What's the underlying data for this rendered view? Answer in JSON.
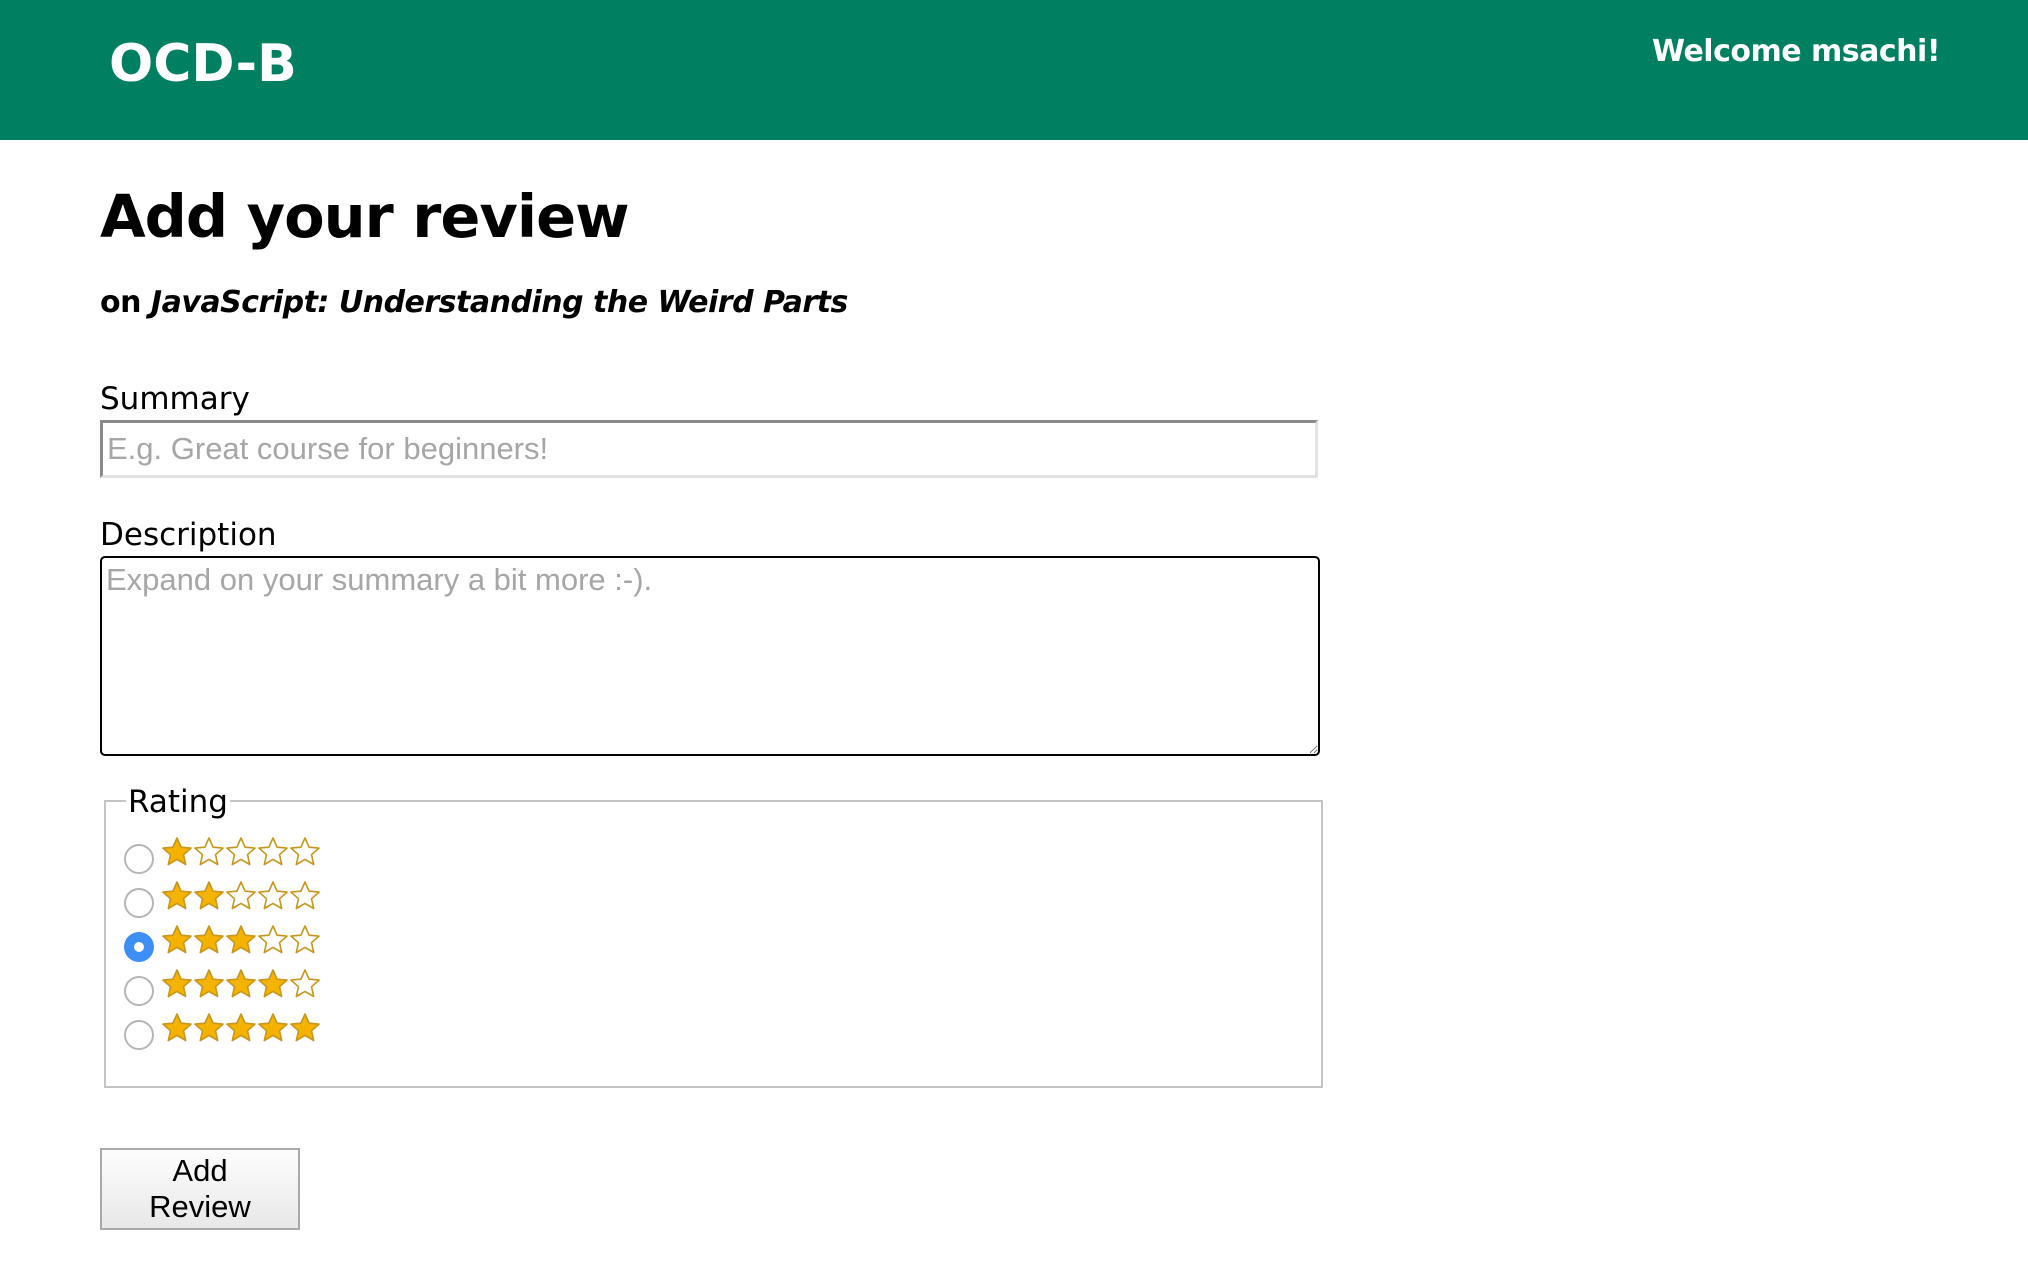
{
  "header": {
    "brand": "OCD-B",
    "welcome": "Welcome msachi!",
    "background_color": "#008061"
  },
  "page": {
    "title": "Add your review",
    "subtitle_prefix": "on",
    "course_title": "JavaScript: Understanding the Weird Parts"
  },
  "form": {
    "summary": {
      "label": "Summary",
      "placeholder": "E.g. Great course for beginners!",
      "value": ""
    },
    "description": {
      "label": "Description",
      "placeholder": "Expand on your summary a bit more :-).",
      "value": ""
    },
    "rating": {
      "legend": "Rating",
      "options": [
        {
          "stars": 1,
          "checked": false
        },
        {
          "stars": 2,
          "checked": false
        },
        {
          "stars": 3,
          "checked": true
        },
        {
          "stars": 4,
          "checked": false
        },
        {
          "stars": 5,
          "checked": false
        }
      ],
      "max_stars": 5,
      "star_fill_color": "#f5b301",
      "star_outline_color": "#c8961a"
    },
    "submit_label": "Add\nReview"
  },
  "icons": {
    "star_filled": "star-filled-icon",
    "star_empty": "star-empty-icon"
  }
}
